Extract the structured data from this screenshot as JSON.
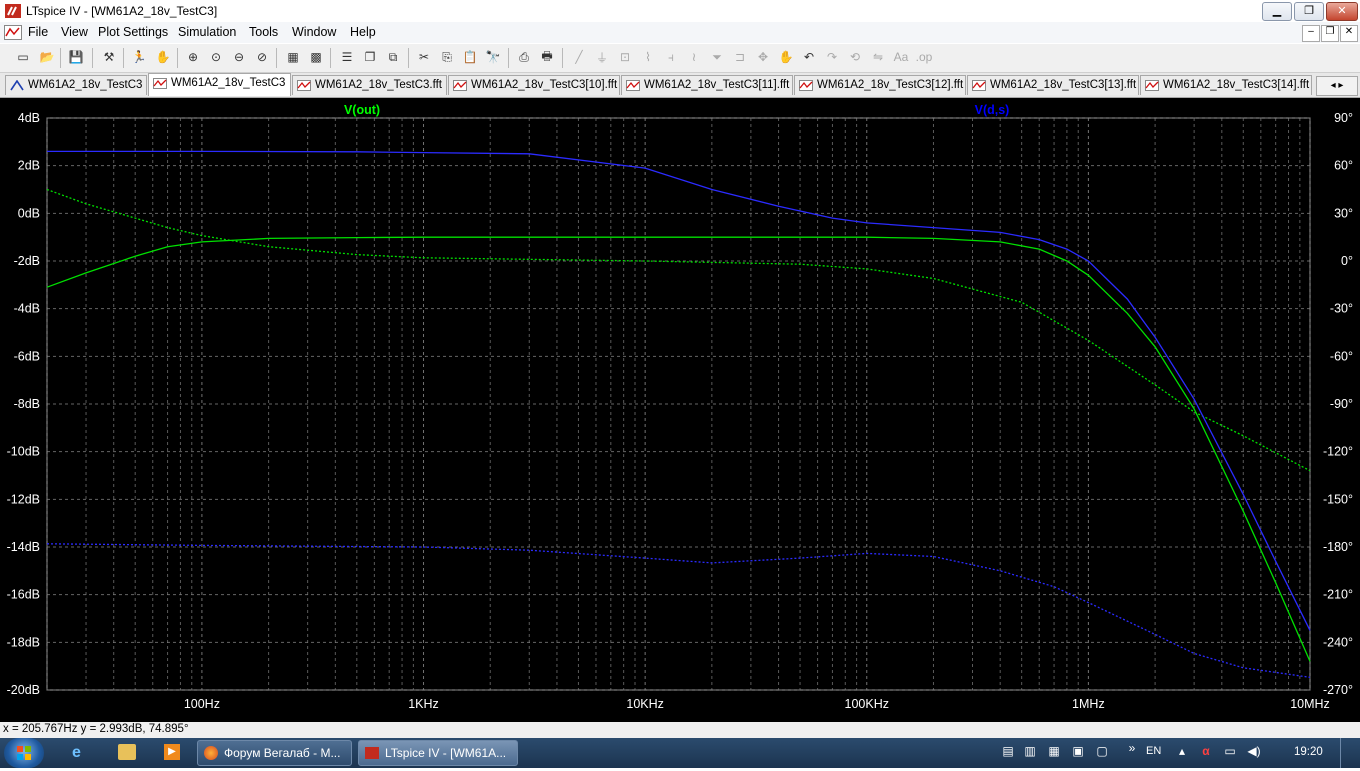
{
  "window": {
    "title": "LTspice IV - [WM61A2_18v_TestC3]",
    "controls": {
      "minimize": "▁",
      "maximize": "❐",
      "close": "✕"
    },
    "doc_controls": {
      "minimize": "–",
      "restore": "❐",
      "close": "✕"
    }
  },
  "menu": {
    "items": [
      {
        "label": "File"
      },
      {
        "label": "View"
      },
      {
        "label": "Plot Settings"
      },
      {
        "label": "Simulation"
      },
      {
        "label": "Tools"
      },
      {
        "label": "Window"
      },
      {
        "label": "Help"
      }
    ]
  },
  "tabs": [
    {
      "label": "WM61A2_18v_TestC3",
      "icon": "schematic-icon",
      "active": false
    },
    {
      "label": "WM61A2_18v_TestC3",
      "icon": "waveform-icon",
      "active": true
    },
    {
      "label": "WM61A2_18v_TestC3.fft",
      "icon": "waveform-icon",
      "active": false
    },
    {
      "label": "WM61A2_18v_TestC3[10].fft",
      "icon": "waveform-icon",
      "active": false
    },
    {
      "label": "WM61A2_18v_TestC3[11].fft",
      "icon": "waveform-icon",
      "active": false
    },
    {
      "label": "WM61A2_18v_TestC3[12].fft",
      "icon": "waveform-icon",
      "active": false
    },
    {
      "label": "WM61A2_18v_TestC3[13].fft",
      "icon": "waveform-icon",
      "active": false
    },
    {
      "label": "WM61A2_18v_TestC3[14].fft",
      "icon": "waveform-icon",
      "active": false
    }
  ],
  "chart_data": {
    "type": "line",
    "x_scale": "log",
    "xlim": [
      20,
      10000000
    ],
    "ylim": [
      -20,
      4
    ],
    "y2lim": [
      -270,
      90
    ],
    "grid": true,
    "x_ticks": [
      {
        "value": 100,
        "label": "100Hz"
      },
      {
        "value": 1000,
        "label": "1KHz"
      },
      {
        "value": 10000,
        "label": "10KHz"
      },
      {
        "value": 100000,
        "label": "100KHz"
      },
      {
        "value": 1000000,
        "label": "1MHz"
      },
      {
        "value": 10000000,
        "label": "10MHz"
      }
    ],
    "y_ticks": [
      "4dB",
      "2dB",
      "0dB",
      "-2dB",
      "-4dB",
      "-6dB",
      "-8dB",
      "-10dB",
      "-12dB",
      "-14dB",
      "-16dB",
      "-18dB",
      "-20dB"
    ],
    "y2_ticks": [
      "90°",
      "60°",
      "30°",
      "0°",
      "-30°",
      "-60°",
      "-90°",
      "-120°",
      "-150°",
      "-180°",
      "-210°",
      "-240°",
      "-270°"
    ],
    "trace_labels": [
      {
        "name": "V(out)",
        "color": "#00ff00"
      },
      {
        "name": "V(d,s)",
        "color": "#0000ff"
      }
    ],
    "series": [
      {
        "name": "V(out)",
        "kind": "magnitude",
        "color": "#00e000",
        "dash": false,
        "x": [
          20,
          30,
          50,
          70,
          100,
          200,
          500,
          1000,
          10000,
          100000,
          200000,
          400000,
          600000,
          800000,
          1000000,
          1500000,
          2000000,
          3000000,
          5000000,
          7000000,
          10000000
        ],
        "y": [
          -3.1,
          -2.5,
          -1.8,
          -1.4,
          -1.2,
          -1.05,
          -1.02,
          -1.0,
          -1.0,
          -1.0,
          -1.05,
          -1.2,
          -1.5,
          -2.0,
          -2.6,
          -4.2,
          -5.6,
          -8.2,
          -12.5,
          -15.5,
          -18.8
        ]
      },
      {
        "name": "V(out)",
        "kind": "phase",
        "color": "#00e000",
        "dash": true,
        "x": [
          20,
          30,
          50,
          70,
          100,
          200,
          500,
          1000,
          10000,
          50000,
          100000,
          200000,
          500000,
          1000000,
          2000000,
          3000000,
          5000000,
          10000000
        ],
        "y": [
          45,
          36,
          27,
          21,
          16,
          9,
          4,
          2,
          0,
          -2,
          -5,
          -11,
          -26,
          -50,
          -78,
          -95,
          -110,
          -132
        ]
      },
      {
        "name": "V(d,s)",
        "kind": "magnitude",
        "color": "#2b2bff",
        "dash": false,
        "x": [
          20,
          100,
          500,
          1000,
          3000,
          10000,
          20000,
          40000,
          70000,
          100000,
          200000,
          400000,
          600000,
          800000,
          1000000,
          1500000,
          2000000,
          3000000,
          5000000,
          7000000,
          10000000
        ],
        "y": [
          2.6,
          2.6,
          2.58,
          2.55,
          2.5,
          1.9,
          1.0,
          0.3,
          -0.2,
          -0.4,
          -0.6,
          -0.8,
          -1.1,
          -1.5,
          -2.0,
          -3.6,
          -5.2,
          -7.8,
          -11.8,
          -14.6,
          -17.5
        ]
      },
      {
        "name": "V(d,s)",
        "kind": "phase",
        "color": "#2b2bff",
        "dash": true,
        "x": [
          20,
          100,
          1000,
          3000,
          10000,
          20000,
          50000,
          100000,
          200000,
          400000,
          700000,
          1000000,
          2000000,
          3000000,
          5000000,
          10000000
        ],
        "y": [
          -178,
          -179,
          -180,
          -182,
          -187,
          -190,
          -187,
          -184,
          -186,
          -195,
          -205,
          -215,
          -235,
          -247,
          -256,
          -262
        ]
      }
    ]
  },
  "status": {
    "cursor_readout": "x = 205.767Hz    y = 2.993dB, 74.895°"
  },
  "taskbar": {
    "tasks": [
      {
        "label": "Форум Вегалаб - M...",
        "icon": "firefox-icon"
      },
      {
        "label": "LTspice IV - [WM61A...",
        "icon": "ltspice-icon"
      }
    ],
    "language": "EN",
    "clock": "19:20"
  }
}
